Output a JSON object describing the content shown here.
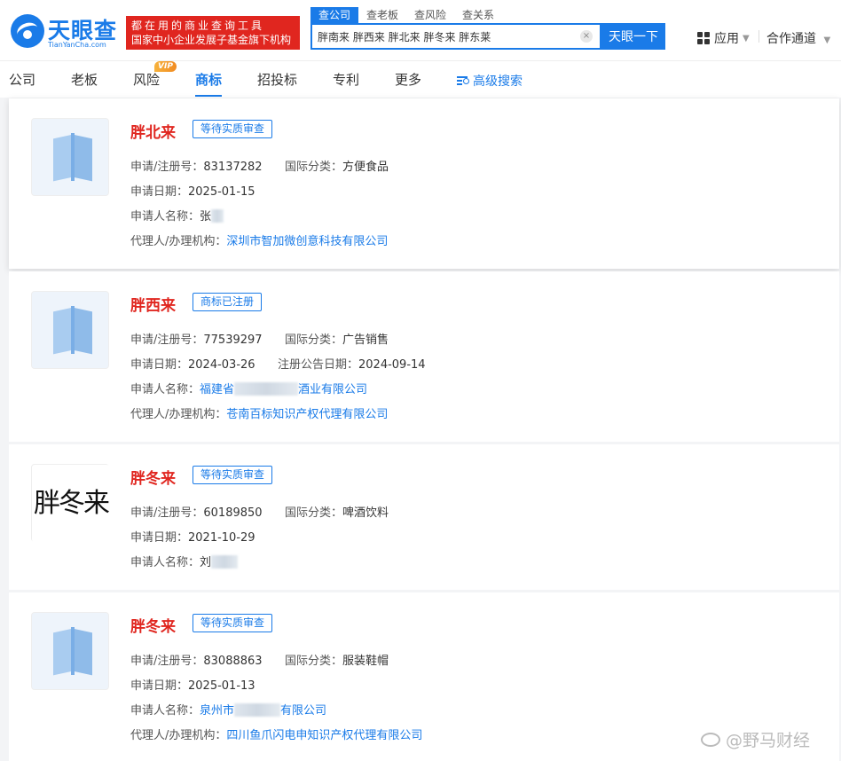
{
  "logo": {
    "name": "天眼查",
    "domain": "TianYanCha.com"
  },
  "slogan": {
    "line1": "都在用的商业查询工具",
    "line2": "国家中小企业发展子基金旗下机构"
  },
  "search": {
    "tabs": [
      "查公司",
      "查老板",
      "查风险",
      "查关系"
    ],
    "value": "胖南来 胖西来 胖北来 胖冬来 胖东莱",
    "clear": "×",
    "button": "天眼一下"
  },
  "topright": {
    "apps": "应用",
    "partner": "合作通道",
    "caret": "▼"
  },
  "nav": {
    "items": [
      "公司",
      "老板",
      "风险",
      "商标",
      "招投标",
      "专利",
      "更多"
    ],
    "vip": "VIP",
    "advanced": "高级搜索"
  },
  "labels": {
    "reg_no": "申请/注册号：",
    "intl_class": "国际分类：",
    "apply_date": "申请日期：",
    "announce_date": "注册公告日期：",
    "applicant": "申请人名称：",
    "agent": "代理人/办理机构："
  },
  "cards": [
    {
      "name": "胖北来",
      "status": "等待实质审查",
      "reg_no": "83137282",
      "intl_class": "方便食品",
      "apply_date": "2025-01-15",
      "applicant": "张",
      "agent": "深圳市智加微创意科技有限公司"
    },
    {
      "name": "胖西来",
      "status": "商标已注册",
      "reg_no": "77539297",
      "intl_class": "广告销售",
      "apply_date": "2024-03-26",
      "announce_date": "2024-09-14",
      "applicant_a": "福建省",
      "applicant_b": "酒业有限公司",
      "agent": "苍南百标知识产权代理有限公司"
    },
    {
      "name": "胖冬来",
      "status": "等待实质审查",
      "image_text": "胖冬来",
      "reg_no": "60189850",
      "intl_class": "啤酒饮料",
      "apply_date": "2021-10-29",
      "applicant": "刘"
    },
    {
      "name": "胖冬来",
      "status": "等待实质审查",
      "reg_no": "83088863",
      "intl_class": "服装鞋帽",
      "apply_date": "2025-01-13",
      "applicant_a": "泉州市",
      "applicant_b": "有限公司",
      "agent": "四川鱼爪闪电申知识产权代理有限公司"
    }
  ],
  "watermark": "@野马财经"
}
